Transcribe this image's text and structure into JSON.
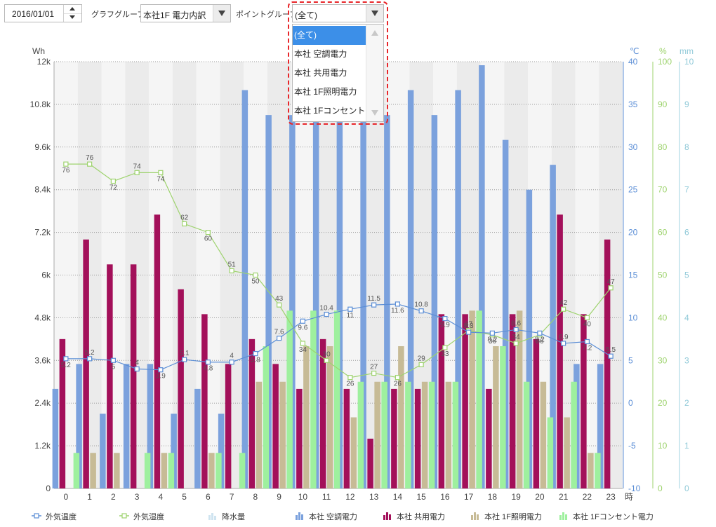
{
  "toolbar": {
    "date_value": "2016/01/01",
    "graph_group_label": "グラフグループ:",
    "graph_group_value": "本社1F 電力内訳",
    "point_group_label": "ポイントグループ:",
    "point_group_value": "(全て)"
  },
  "point_group_dropdown": {
    "options": [
      "(全て)",
      "本社 空調電力",
      "本社 共用電力",
      "本社 1F照明電力",
      "本社 1Fコンセント電力"
    ],
    "selected_index": 0
  },
  "colors": {
    "aircon": "#7ba1dd",
    "common": "#a3105a",
    "lighting": "#c7bb96",
    "outlet": "#9ef09e",
    "temp": "#5b8ed6",
    "humidity": "#9ed36e",
    "rain": "#cfe4f0",
    "highlight": "#e8262a",
    "selected_option": "#3c8fe8"
  },
  "chart_data": {
    "type": "bar",
    "x_unit": "時",
    "categories": [
      "0",
      "1",
      "2",
      "3",
      "4",
      "5",
      "6",
      "7",
      "8",
      "9",
      "10",
      "11",
      "12",
      "13",
      "14",
      "15",
      "16",
      "17",
      "18",
      "19",
      "20",
      "21",
      "22",
      "23"
    ],
    "y_left": {
      "unit": "Wh",
      "range": [
        0,
        12000
      ],
      "ticks": [
        "0",
        "1.2k",
        "2.4k",
        "3.6k",
        "4.8k",
        "6k",
        "7.2k",
        "8.4k",
        "9.6k",
        "10.8k",
        "12k"
      ]
    },
    "y_temp": {
      "unit": "℃",
      "range": [
        -10,
        40
      ],
      "ticks": [
        "-10",
        "-5",
        "0",
        "5",
        "10",
        "15",
        "20",
        "25",
        "30",
        "35",
        "40"
      ]
    },
    "y_humidity": {
      "unit": "%",
      "range": [
        0,
        100
      ],
      "ticks": [
        "0",
        "10",
        "20",
        "30",
        "40",
        "50",
        "60",
        "70",
        "80",
        "90",
        "100"
      ]
    },
    "y_rain": {
      "unit": "mm",
      "range": [
        0,
        10
      ],
      "ticks": [
        "0",
        "1",
        "2",
        "3",
        "4",
        "5",
        "6",
        "7",
        "8",
        "9",
        "10"
      ]
    },
    "grid": true,
    "legend_position": "bottom",
    "series": [
      {
        "name": "本社 空調電力",
        "axis": "left",
        "type": "bar",
        "color_key": "aircon",
        "values": [
          2800,
          3500,
          2100,
          3500,
          3500,
          2100,
          2800,
          2100,
          11200,
          10500,
          10500,
          10500,
          10500,
          10500,
          10500,
          11200,
          10500,
          11200,
          11900,
          9800,
          8400,
          9100,
          3500,
          3500
        ]
      },
      {
        "name": "本社 共用電力",
        "axis": "left",
        "type": "bar",
        "color_key": "common",
        "values": [
          4200,
          7000,
          6300,
          6300,
          7700,
          5600,
          4900,
          3500,
          4200,
          3500,
          2800,
          4200,
          2800,
          1400,
          2800,
          2800,
          4900,
          4900,
          2800,
          4900,
          4200,
          7700,
          4900,
          7000
        ]
      },
      {
        "name": "本社 1F照明電力",
        "axis": "left",
        "type": "bar",
        "color_key": "lighting",
        "values": [
          0,
          1000,
          1000,
          0,
          1000,
          0,
          1000,
          0,
          3000,
          3000,
          4000,
          4000,
          2000,
          3000,
          4000,
          3000,
          3000,
          5000,
          4000,
          5000,
          3000,
          2000,
          1000,
          0
        ]
      },
      {
        "name": "本社 1Fコンセント電力",
        "axis": "left",
        "type": "bar",
        "color_key": "outlet",
        "values": [
          1000,
          0,
          0,
          1000,
          1000,
          0,
          1000,
          1000,
          4000,
          5000,
          5000,
          5000,
          3000,
          3000,
          3000,
          3000,
          3000,
          5000,
          4000,
          3000,
          2000,
          3000,
          1000,
          0
        ]
      },
      {
        "name": "外気温度",
        "axis": "temp",
        "type": "line",
        "color_key": "temp",
        "values": [
          5.2,
          5.2,
          5,
          4,
          3.9,
          5.1,
          4.8,
          4.8,
          5.8,
          7.6,
          9.6,
          10.4,
          11,
          11.5,
          11.6,
          10.8,
          9.9,
          8.3,
          8.2,
          8.6,
          8.2,
          7,
          7.2,
          5.5
        ],
        "labels": [
          "5.2",
          "5.2",
          "5",
          "4",
          "3.9",
          "5.1",
          "4.8",
          "4",
          "5.8",
          "7.6",
          "9.6",
          "10.4",
          "11",
          "11.5",
          "11.6",
          "10.8",
          "9.9",
          "8.3",
          "8.2",
          "8.6",
          "8.2",
          "6.9",
          "7.2",
          "5.5"
        ]
      },
      {
        "name": "外気湿度",
        "axis": "humidity",
        "type": "line",
        "color_key": "humidity",
        "values": [
          76,
          76,
          72,
          74,
          74,
          62,
          60,
          51,
          50,
          43,
          34,
          30,
          26,
          27,
          26,
          29,
          33,
          37,
          36,
          34,
          36,
          42,
          40,
          47
        ],
        "labels": [
          "76",
          "76",
          "72",
          "74",
          "74",
          "62",
          "60",
          "51",
          "50",
          "43",
          "34",
          "30",
          "26",
          "27",
          "26",
          "29",
          "33",
          "37",
          "36",
          "34",
          "36",
          "42",
          "40",
          "47"
        ]
      },
      {
        "name": "降水量",
        "axis": "rain",
        "type": "bar",
        "color_key": "rain",
        "values": [
          0,
          0,
          0,
          0,
          0,
          0,
          0,
          0,
          0,
          0,
          0,
          0,
          0,
          0,
          0,
          0,
          0,
          0,
          0,
          0,
          0,
          0,
          0,
          0
        ]
      }
    ],
    "legend": [
      "外気温度",
      "外気湿度",
      "降水量",
      "本社 空調電力",
      "本社 共用電力",
      "本社 1F照明電力",
      "本社 1Fコンセント電力"
    ]
  }
}
